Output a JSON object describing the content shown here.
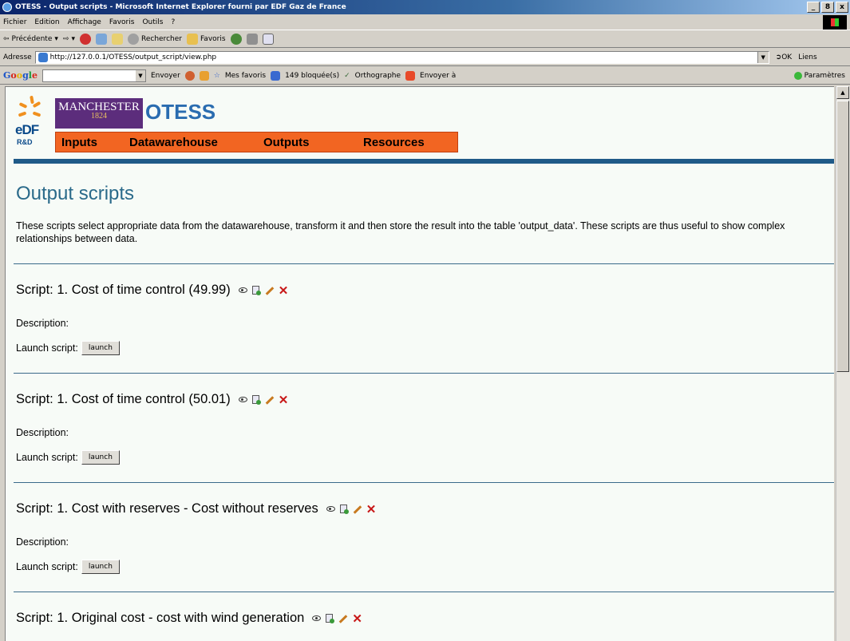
{
  "window": {
    "title": "OTESS - Output scripts - Microsoft Internet Explorer fourni par EDF Gaz de France",
    "controls": [
      "_",
      "8",
      "x"
    ]
  },
  "menu": [
    "Fichier",
    "Edition",
    "Affichage",
    "Favoris",
    "Outils",
    "?"
  ],
  "toolbar": {
    "back": "Précédente",
    "search": "Rechercher",
    "favorites": "Favoris"
  },
  "address": {
    "label": "Adresse",
    "url": "http://127.0.0.1/OTESS/output_script/view.php",
    "go": "OK",
    "links": "Liens"
  },
  "google_bar": {
    "send": "Envoyer",
    "favorites": "Mes favoris",
    "blocked": "149 bloquée(s)",
    "spelling": "Orthographe",
    "send_to": "Envoyer à",
    "settings": "Paramètres"
  },
  "header": {
    "edf": "eDF",
    "rd": "R&D",
    "manchester": "MANCHESTER",
    "manchester_year": "1824",
    "app_title": "OTESS",
    "nav": [
      "Inputs",
      "Datawarehouse",
      "Outputs",
      "Resources"
    ]
  },
  "page": {
    "title": "Output scripts",
    "intro": "These scripts select appropriate data from the datawarehouse, transform it and then store the result into the table 'output_data'. These scripts are thus useful to show complex relationships between data."
  },
  "scripts": [
    {
      "title": "Script: 1. Cost of time control (49.99)",
      "description_label": "Description:",
      "launch_label": "Launch script:",
      "launch_button": "launch"
    },
    {
      "title": "Script: 1. Cost of time control (50.01)",
      "description_label": "Description:",
      "launch_label": "Launch script:",
      "launch_button": "launch"
    },
    {
      "title": "Script: 1. Cost with reserves - Cost without reserves",
      "description_label": "Description:",
      "launch_label": "Launch script:",
      "launch_button": "launch"
    },
    {
      "title": "Script: 1. Original cost - cost with wind generation"
    }
  ],
  "icons": {
    "delete_color": "#c81818",
    "nav_color": "#f26522",
    "title_color": "#2a6a8a"
  }
}
